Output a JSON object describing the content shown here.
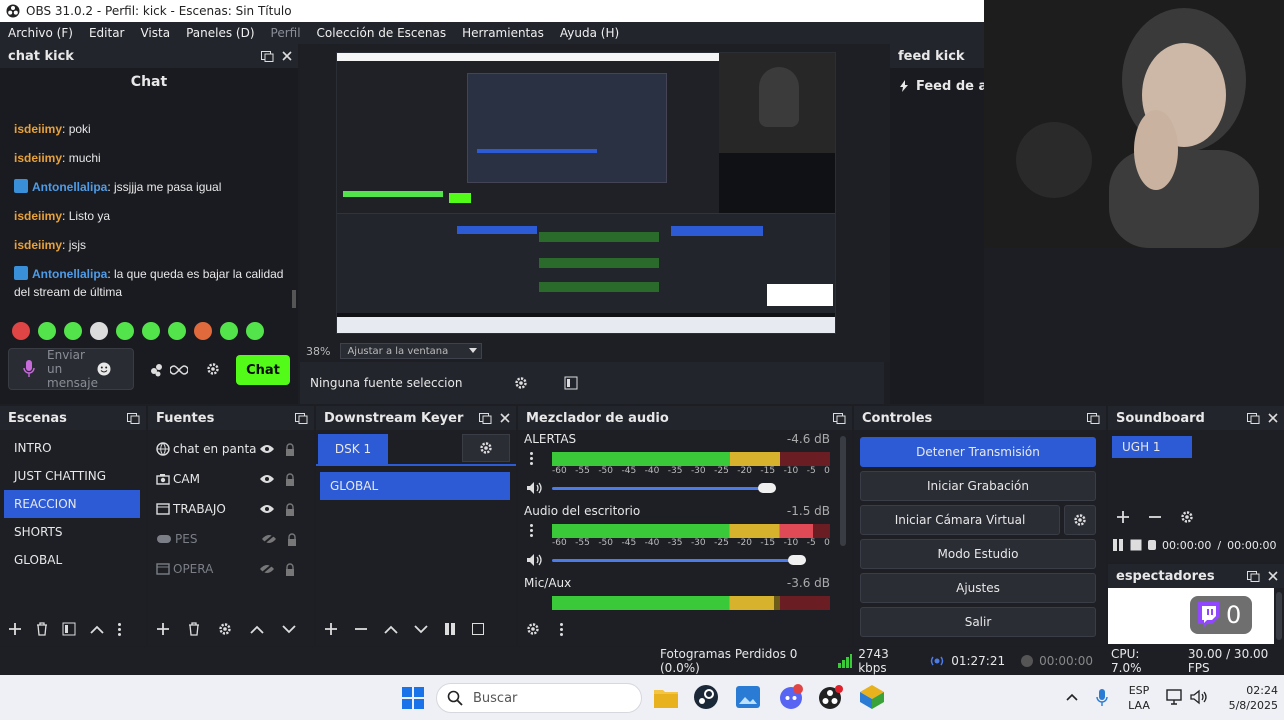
{
  "window": {
    "title": "OBS 31.0.2 - Perfil: kick - Escenas: Sin Título"
  },
  "menu": [
    {
      "label": "Archivo (F)",
      "enabled": true
    },
    {
      "label": "Editar",
      "enabled": true
    },
    {
      "label": "Vista",
      "enabled": true
    },
    {
      "label": "Paneles (D)",
      "enabled": true
    },
    {
      "label": "Perfil",
      "enabled": false
    },
    {
      "label": "Colección de Escenas",
      "enabled": true
    },
    {
      "label": "Herramientas",
      "enabled": true
    },
    {
      "label": "Ayuda (H)",
      "enabled": true
    }
  ],
  "chat": {
    "dock_title": "chat kick",
    "panel_title": "Chat",
    "messages": [
      {
        "user": "isdeiimy",
        "text": ": poki",
        "badge": false
      },
      {
        "user": "isdeiimy",
        "text": ": muchi",
        "badge": false
      },
      {
        "user": "Antonellalipa",
        "text": ": jssjjja me pasa igual",
        "badge": true
      },
      {
        "user": "isdeiimy",
        "text": ": Listo ya",
        "badge": false
      },
      {
        "user": "isdeiimy",
        "text": ": jsjs",
        "badge": false
      },
      {
        "user": "Antonellalipa",
        "text": ": la que queda es bajar la calidad del stream de última",
        "badge": true
      }
    ],
    "input_placeholder": "Enviar un mensaje",
    "send_label": "Chat"
  },
  "preview": {
    "zoom": "38%",
    "zoom_mode": "Ajustar a la ventana",
    "no_source": "Ninguna fuente selecciona"
  },
  "feed": {
    "dock_title": "feed kick",
    "label": "Feed de ac"
  },
  "scenes": {
    "title": "Escenas",
    "selected": "REACCION",
    "items": [
      "INTRO",
      "JUST CHATTING",
      "REACCION",
      "SHORTS",
      "GLOBAL"
    ]
  },
  "sources": {
    "title": "Fuentes",
    "items": [
      {
        "label": "chat en pantall",
        "icon": "browser-icon",
        "visible": true
      },
      {
        "label": "CAM",
        "icon": "camera-icon",
        "visible": true
      },
      {
        "label": "TRABAJO",
        "icon": "window-capture-icon",
        "visible": true
      },
      {
        "label": "PES",
        "icon": "gamepad-icon",
        "visible": false
      },
      {
        "label": "OPERA",
        "icon": "window-capture-icon",
        "visible": false
      }
    ]
  },
  "dsk": {
    "title": "Downstream Keyer",
    "tab": "DSK 1",
    "items": [
      "GLOBAL"
    ]
  },
  "mixer": {
    "title": "Mezclador de audio",
    "ticks": [
      "-60",
      "-55",
      "-50",
      "-45",
      "-40",
      "-35",
      "-30",
      "-25",
      "-20",
      "-15",
      "-10",
      "-5",
      "0"
    ],
    "channels": [
      {
        "name": "ALERTAS",
        "db": "-4.6 dB",
        "level": 0.82
      },
      {
        "name": "Audio del escritorio",
        "db": "-1.5 dB",
        "level": 0.94
      },
      {
        "name": "Mic/Aux",
        "db": "-3.6 dB",
        "level": 0.8
      }
    ]
  },
  "controls": {
    "title": "Controles",
    "buttons": [
      "Detener Transmisión",
      "Iniciar Grabación",
      "Iniciar Cámara Virtual",
      "Modo Estudio",
      "Ajustes",
      "Salir"
    ]
  },
  "soundboard": {
    "title": "Soundboard",
    "items": [
      "UGH 1"
    ],
    "time_current": "00:00:00",
    "time_total": "00:00:00"
  },
  "viewers": {
    "title": "espectadores",
    "count": "0"
  },
  "status": {
    "dropped": "Fotogramas Perdidos 0 (0.0%)",
    "bitrate": "2743 kbps",
    "live_time": "01:27:21",
    "rec_time": "00:00:00",
    "cpu": "CPU: 7.0%",
    "fps": "30.00 / 30.00 FPS"
  },
  "taskbar": {
    "search_placeholder": "Buscar",
    "lang1": "ESP",
    "lang2": "LAA",
    "time": "02:24",
    "date": "5/8/2025"
  },
  "colors": {
    "accent": "#2d5bd6",
    "kick_green": "#53fc18",
    "twitch_purple": "#9146ff"
  }
}
